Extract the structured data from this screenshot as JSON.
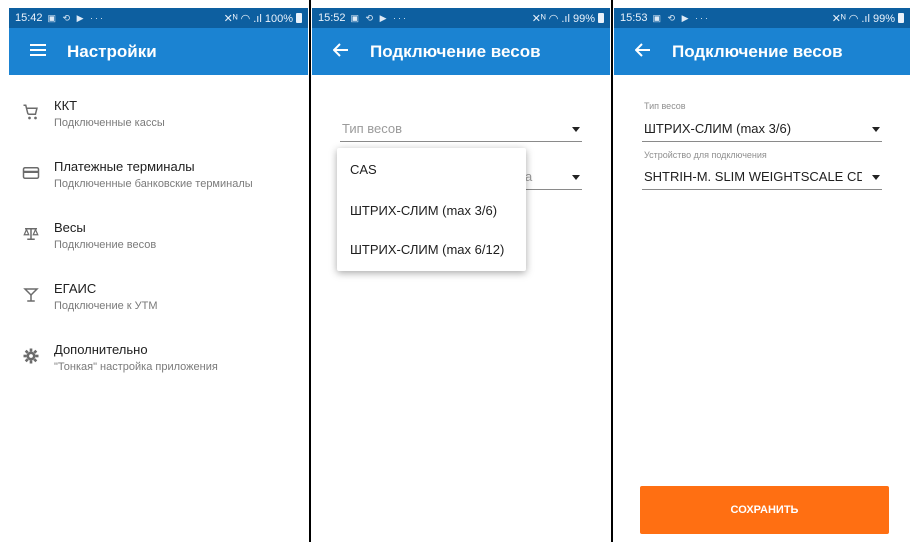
{
  "screen1": {
    "status": {
      "time": "15:42",
      "icons": "▣ ⟲ ▶ ···",
      "right": "✕ᴺ ◠ .ıl 100%"
    },
    "appbar": {
      "nav_icon": "menu-icon",
      "title": "Настройки"
    },
    "menu": [
      {
        "icon": "cart-icon",
        "title": "ККТ",
        "subtitle": "Подключенные кассы"
      },
      {
        "icon": "card-icon",
        "title": "Платежные терминалы",
        "subtitle": "Подключенные банковские терминалы"
      },
      {
        "icon": "scale-icon",
        "title": "Весы",
        "subtitle": "Подключение весов"
      },
      {
        "icon": "cocktail-icon",
        "title": "ЕГАИС",
        "subtitle": "Подключение к УТМ"
      },
      {
        "icon": "gear-icon",
        "title": "Дополнительно",
        "subtitle": "\"Тонкая\" настройка приложения"
      }
    ]
  },
  "screen2": {
    "status": {
      "time": "15:52",
      "icons": "▣ ⟲ ▶ ···",
      "right": "✕ᴺ ◠ .ıl 99%"
    },
    "appbar": {
      "nav_icon": "back-arrow-icon",
      "title": "Подключение весов"
    },
    "field_type_placeholder": "Тип весов",
    "field_device_partial": "а",
    "dropdown_options": [
      "CAS",
      "ШТРИХ-СЛИМ (max 3/6)",
      "ШТРИХ-СЛИМ (max 6/12)"
    ]
  },
  "screen3": {
    "status": {
      "time": "15:53",
      "icons": "▣ ⟲ ▶ ···",
      "right": "✕ᴺ ◠ .ıl 99%"
    },
    "appbar": {
      "nav_icon": "back-arrow-icon",
      "title": "Подключение весов"
    },
    "type_label": "Тип весов",
    "type_value": "ШТРИХ-СЛИМ (max 3/6)",
    "device_label": "Устройство для подключения",
    "device_value": "SHTRIH-M. SLIM WEIGHTSCALE CDC",
    "save_label": "СОХРАНИТЬ"
  },
  "colors": {
    "appbar": "#1b83d2",
    "statusbar": "#0d5fa0",
    "save_button": "#ff6f12"
  }
}
